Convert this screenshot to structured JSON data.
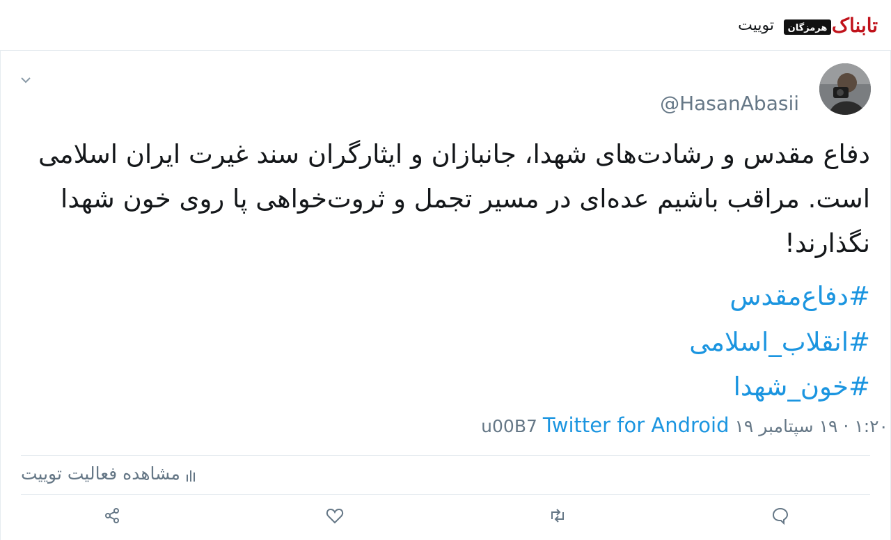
{
  "header": {
    "title": "توییت",
    "logo_text": "تابناک",
    "logo_subtext": "هرمزگان"
  },
  "tweet": {
    "handle": "@HasanAbasii",
    "text": "دفاع مقدس و رشادت‌های شهدا، جانبازان و ایثارگران سند غیرت ایران اسلامی است. مراقب باشیم عده‌ای در مسیر تجمل و ثروت‌خواهی پا روی خون شهدا نگذارند!",
    "hashtags": [
      "#دفاع‌مقدس",
      "#انقلاب_اسلامی",
      "#خون_شهدا"
    ],
    "timestamp": "۱:۲۰ · ۱۹ سپتامبر ۱۹",
    "separator": "u00B7",
    "source": "Twitter for Android",
    "activity_label": "مشاهده فعالیت توییت"
  },
  "actions": [
    "reply-icon",
    "retweet-icon",
    "like-icon",
    "share-icon"
  ],
  "colors": {
    "link": "#1b95e0",
    "muted": "#657786",
    "text": "#14171a",
    "border": "#e6ecf0"
  }
}
